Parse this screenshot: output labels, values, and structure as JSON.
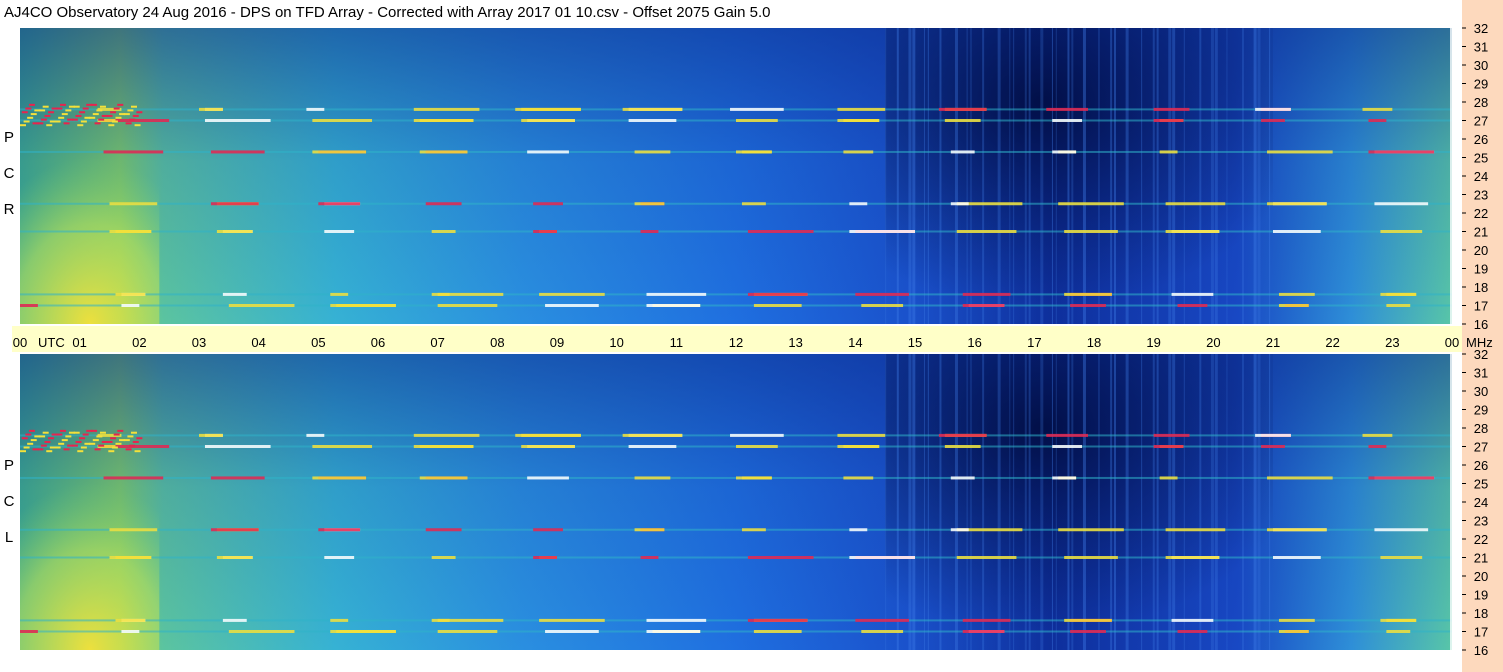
{
  "title": "AJ4CO Observatory  24 Aug 2016  -  DPS on TFD Array  -  Corrected with Array 2017 01 10.csv  -  Offset 2075  Gain 5.0",
  "colors": {
    "time_band": "#ffffc8",
    "right_strip": "#fdd9bd",
    "low": "#1d5bd6",
    "mid": "#2fb2c8",
    "high": "#f4e13a",
    "peak": "#e8234e"
  },
  "chart_data": [
    {
      "type": "heatmap",
      "polarization": [
        "R",
        "C",
        "P"
      ],
      "x": [
        "00",
        "01",
        "02",
        "03",
        "04",
        "05",
        "06",
        "07",
        "08",
        "09",
        "10",
        "11",
        "12",
        "13",
        "14",
        "15",
        "16",
        "17",
        "18",
        "19",
        "20",
        "21",
        "22",
        "23",
        "00"
      ],
      "x_unit": "UTC",
      "xlim": [
        0,
        24
      ],
      "y": [
        16,
        17,
        18,
        19,
        20,
        21,
        22,
        23,
        24,
        25,
        26,
        27,
        28,
        29,
        30,
        31,
        32
      ],
      "y_unit": "MHz",
      "ylim": [
        16,
        32
      ],
      "features": {
        "bright_bands_mhz": [
          17.0,
          17.6,
          21.0,
          22.5,
          25.3,
          27.0,
          27.6
        ],
        "strong_region_utc": [
          0.0,
          2.0
        ],
        "dark_region_utc": [
          14.5,
          21.0
        ]
      }
    },
    {
      "type": "heatmap",
      "polarization": [
        "L",
        "C",
        "P"
      ],
      "x": [
        "00",
        "01",
        "02",
        "03",
        "04",
        "05",
        "06",
        "07",
        "08",
        "09",
        "10",
        "11",
        "12",
        "13",
        "14",
        "15",
        "16",
        "17",
        "18",
        "19",
        "20",
        "21",
        "22",
        "23",
        "00"
      ],
      "x_unit": "UTC",
      "xlim": [
        0,
        24
      ],
      "y": [
        16,
        17,
        18,
        19,
        20,
        21,
        22,
        23,
        24,
        25,
        26,
        27,
        28,
        29,
        30,
        31,
        32
      ],
      "y_unit": "MHz",
      "ylim": [
        16,
        32
      ],
      "features": {
        "bright_bands_mhz": [
          17.0,
          17.6,
          21.0,
          22.5,
          25.3,
          27.0,
          27.6
        ],
        "strong_region_utc": [
          0.0,
          2.0
        ],
        "dark_region_utc": [
          14.5,
          21.0
        ]
      }
    }
  ]
}
